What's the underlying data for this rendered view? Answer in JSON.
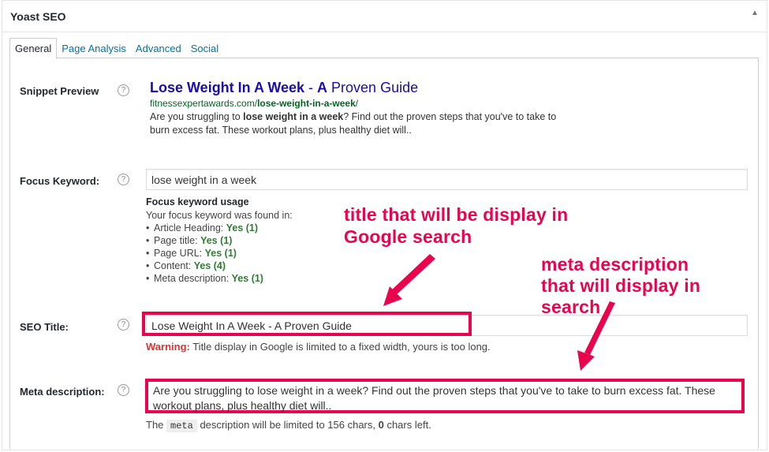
{
  "panel": {
    "title": "Yoast SEO"
  },
  "tabs": [
    {
      "label": "General"
    },
    {
      "label": "Page Analysis"
    },
    {
      "label": "Advanced"
    },
    {
      "label": "Social"
    }
  ],
  "snippet": {
    "label": "Snippet Preview",
    "title_bold": "Lose Weight In A Week",
    "title_sep": " - ",
    "title_bold2": "A",
    "title_rest": " Proven Guide",
    "url_plain": "fitnessexpertawards.com/",
    "url_bold": "lose-weight-in-a-week",
    "url_tail": "/",
    "desc_pre": "Are you struggling to ",
    "desc_bold": "lose weight in a week",
    "desc_post": "? Find out the proven steps that you've to take to burn excess fat. These workout plans, plus healthy diet will.."
  },
  "focus": {
    "label": "Focus Keyword:",
    "value": "lose weight in a week",
    "usage_title": "Focus keyword usage",
    "usage_intro": "Your focus keyword was found in:",
    "items": [
      {
        "label": "Article Heading:",
        "result": "Yes (1)"
      },
      {
        "label": "Page title:",
        "result": "Yes (1)"
      },
      {
        "label": "Page URL:",
        "result": "Yes (1)"
      },
      {
        "label": "Content:",
        "result": "Yes (4)"
      },
      {
        "label": "Meta description:",
        "result": "Yes (1)"
      }
    ]
  },
  "seo_title": {
    "label": "SEO Title:",
    "value": "Lose Weight In A Week - A Proven Guide",
    "warning_label": "Warning:",
    "warning_text": " Title display in Google is limited to a fixed width, yours is too long."
  },
  "meta": {
    "label": "Meta description:",
    "value": "Are you struggling to lose weight in a week? Find out the proven steps that you've to take to burn excess fat. These workout plans, plus healthy diet will..",
    "note_pre": "The ",
    "note_code": "meta",
    "note_mid": " description will be limited to 156 chars, ",
    "note_count": "0",
    "note_post": " chars left."
  },
  "help_icon": "question-circle-icon",
  "annotations": {
    "title_note": "title that will be display in Google search",
    "meta_note": "meta description that will display in search"
  },
  "colors": {
    "highlight": "#e8054e",
    "link": "#0073aa",
    "serp_title": "#1a0dab",
    "serp_url": "#006621",
    "ok": "#2e7d32"
  }
}
